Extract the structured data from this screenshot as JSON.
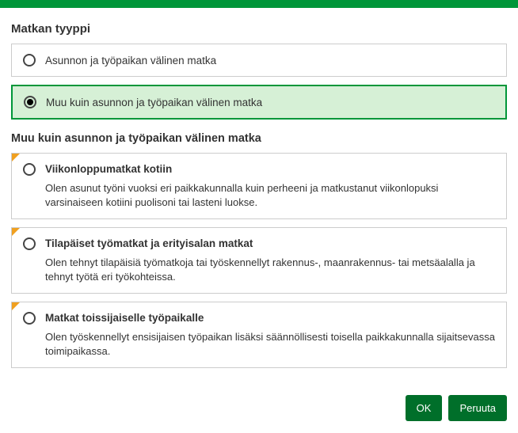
{
  "section1": {
    "title": "Matkan tyyppi",
    "options": [
      {
        "label": "Asunnon ja työpaikan välinen matka",
        "selected": false
      },
      {
        "label": "Muu kuin asunnon ja työpaikan välinen matka",
        "selected": true
      }
    ]
  },
  "section2": {
    "title": "Muu kuin asunnon ja työpaikan välinen matka",
    "options": [
      {
        "title": "Viikonloppumatkat kotiin",
        "desc": "Olen asunut työni vuoksi eri paikkakunnalla kuin perheeni ja matkustanut viikonlopuksi varsinaiseen kotiini puolisoni tai lasteni luokse."
      },
      {
        "title": "Tilapäiset työmatkat ja erityisalan matkat",
        "desc": "Olen tehnyt tilapäisiä työmatkoja tai työskennellyt rakennus-, maanrakennus- tai metsäalalla ja tehnyt työtä eri työkohteissa."
      },
      {
        "title": "Matkat toissijaiselle työpaikalle",
        "desc": "Olen työskennellyt ensisijaisen työpaikan lisäksi säännöllisesti toisella paikkakunnalla sijaitsevassa toimipaikassa."
      }
    ]
  },
  "buttons": {
    "ok": "OK",
    "cancel": "Peruuta"
  }
}
